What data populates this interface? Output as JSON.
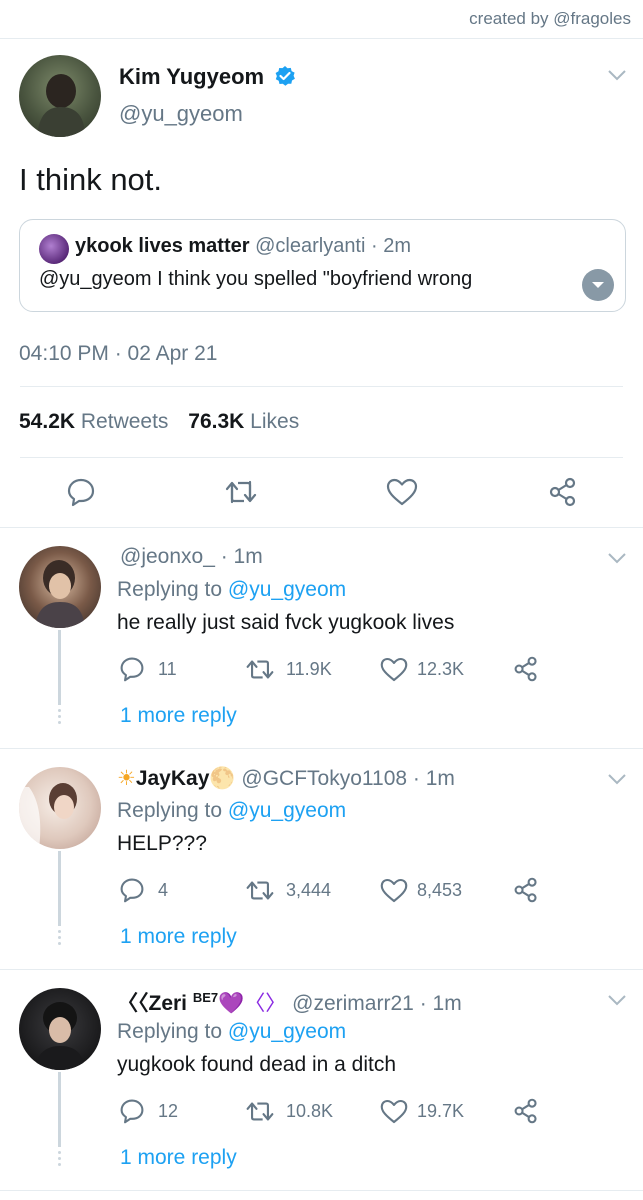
{
  "credit": "created by @fragoles",
  "tweet": {
    "name": "Kim Yugyeom",
    "handle": "@yu_gyeom",
    "text": "I think not.",
    "quote": {
      "name": "ykook lives matter",
      "handle": "@clearlyanti",
      "time": "· 2m",
      "text": "@yu_gyeom I think you spelled \"boyfriend wrong"
    },
    "timestamp": "04:10 PM · 02 Apr 21",
    "retweets_count": "54.2K",
    "retweets_label": "Retweets",
    "likes_count": "76.3K",
    "likes_label": "Likes"
  },
  "colors": {
    "accent": "#1da1f2",
    "secondary_text": "#657786",
    "divider": "#e6ecf0"
  },
  "replies": [
    {
      "name": "",
      "handle": "@jeonxo_",
      "time": "· 1m",
      "replying_prefix": "Replying to",
      "replying_to": "@yu_gyeom",
      "text": "he really just said fvck yugkook lives",
      "comments": "11",
      "retweets": "11.9K",
      "likes": "12.3K",
      "more": "1 more reply"
    },
    {
      "name": "JayKay",
      "name_prefix_emoji": "☀",
      "name_suffix_emoji": "🌕",
      "handle": "@GCFTokyo1108",
      "time": "· 1m",
      "replying_prefix": "Replying to",
      "replying_to": "@yu_gyeom",
      "text": "HELP???",
      "comments": "4",
      "retweets": "3,444",
      "likes": "8,453",
      "more": "1 more reply"
    },
    {
      "name": "Zeri",
      "name_prefix_emoji": "〈〈",
      "superscript": "BE7",
      "name_suffix_emoji": "💜〈〉",
      "handle": "@zerimarr21",
      "time": "· 1m",
      "replying_prefix": "Replying to",
      "replying_to": "@yu_gyeom",
      "text": "yugkook found dead in a ditch",
      "comments": "12",
      "retweets": "10.8K",
      "likes": "19.7K",
      "more": "1 more reply"
    }
  ]
}
